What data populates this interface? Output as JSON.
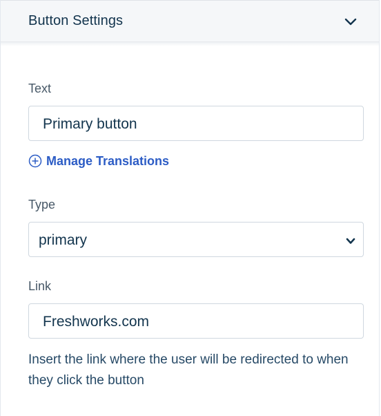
{
  "header": {
    "title": "Button Settings",
    "collapse_icon": "chevron-down-icon"
  },
  "text_field": {
    "label": "Text",
    "value": "Primary button"
  },
  "translations": {
    "icon": "plus-circle-icon",
    "label": "Manage Translations",
    "color": "#2c5cc5"
  },
  "type_field": {
    "label": "Type",
    "selected": "primary",
    "dropdown_icon": "chevron-down-icon"
  },
  "link_field": {
    "label": "Link",
    "value": "Freshworks.com",
    "helper": "Insert the link where the user will be redirected to when they click the button"
  }
}
